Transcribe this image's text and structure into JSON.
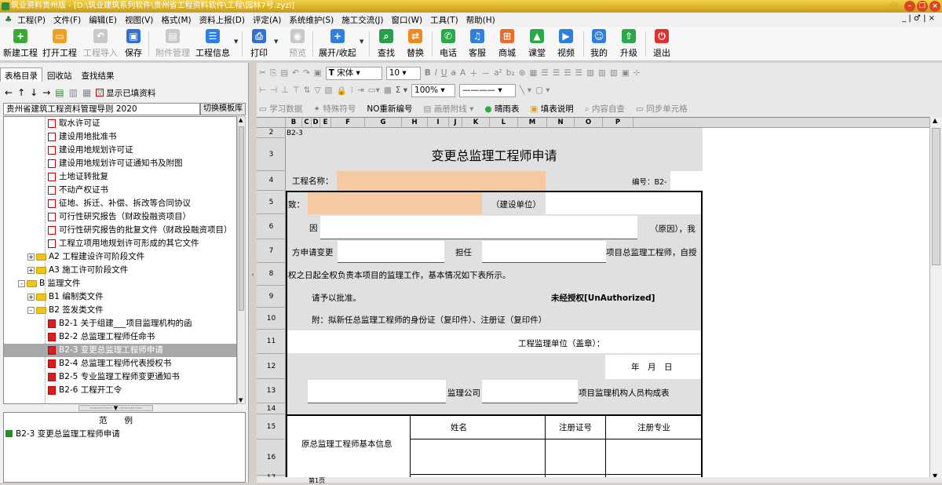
{
  "titlebar": {
    "text": "筑业资料贵州版 - [D:\\筑业建筑系列软件\\贵州省工程资料软件\\工程\\园林7号.zyzl]"
  },
  "menu": [
    "工程(P)",
    "文件(F)",
    "编辑(E)",
    "视图(V)",
    "格式(M)",
    "资料上报(D)",
    "评定(A)",
    "系统维护(S)",
    "施工交流(J)",
    "窗口(W)",
    "工具(T)",
    "帮助(H)"
  ],
  "menu_mdi": "_ | ♂ | ×",
  "toolbar": {
    "new": "新建工程",
    "open": "打开工程",
    "import": "工程导入",
    "save": "保存",
    "attach": "附件管理",
    "info": "工程信息",
    "print": "打印",
    "preview": "预览",
    "expand": "展开/收起",
    "search": "查找",
    "replace": "替换",
    "phone": "电话",
    "service": "客服",
    "shop": "商城",
    "classroom": "课堂",
    "video": "视频",
    "mine": "我的",
    "upgrade": "升级",
    "exit": "退出"
  },
  "colors": {
    "new": "#3aaa35",
    "open": "#f0a020",
    "save": "#2f6fd6",
    "info": "#2f7fe0",
    "expand": "#2f7fe0",
    "search": "#2a9d4a",
    "replace": "#f08a1e",
    "phone": "#2aa84a",
    "service": "#2f7fe0",
    "shop": "#f06a2a",
    "classroom": "#2aa84a",
    "video": "#2f7fe0",
    "mine": "#2f7fe0",
    "upgrade": "#2aa84a",
    "exit": "#e03030",
    "peach": "#f4c9a3"
  },
  "left": {
    "tabs": [
      "表格目录",
      "回收站",
      "查找结果"
    ],
    "show_filled": "显示已填资料",
    "standard": "贵州省建筑工程资料管理导则 2020",
    "switch_template": "切换模板库",
    "tree": [
      {
        "label": "取水许可证",
        "level": 3,
        "kind": "doc"
      },
      {
        "label": "建设用地批准书",
        "level": 3,
        "kind": "doc"
      },
      {
        "label": "建设用地规划许可证",
        "level": 3,
        "kind": "doc"
      },
      {
        "label": "建设用地规划许可证通知书及附图",
        "level": 3,
        "kind": "doc"
      },
      {
        "label": "土地证转批复",
        "level": 3,
        "kind": "doc"
      },
      {
        "label": "不动产权证书",
        "level": 3,
        "kind": "doc"
      },
      {
        "label": "征地、拆迁、补偿、拆改等合同协议",
        "level": 3,
        "kind": "doc"
      },
      {
        "label": "可行性研究报告（财政投融资项目）",
        "level": 3,
        "kind": "doc"
      },
      {
        "label": "可行性研究报告的批复文件（财政投融资项目）",
        "level": 3,
        "kind": "doc"
      },
      {
        "label": "工程立项用地规划许可形成的其它文件",
        "level": 3,
        "kind": "doc"
      },
      {
        "label": "A2 工程建设许可阶段文件",
        "level": 2,
        "kind": "folder",
        "exp": "+"
      },
      {
        "label": "A3 施工许可阶段文件",
        "level": 2,
        "kind": "folder",
        "exp": "+"
      },
      {
        "label": "B 监理文件",
        "level": 1,
        "kind": "folder",
        "exp": "-"
      },
      {
        "label": "B1 编制类文件",
        "level": 2,
        "kind": "folder",
        "exp": "+"
      },
      {
        "label": "B2 签发类文件",
        "level": 2,
        "kind": "folder",
        "exp": "-"
      },
      {
        "label": "B2-1 关于组建___项目监理机构的函",
        "level": 3,
        "kind": "xdoc"
      },
      {
        "label": "B2-2 总监理工程师任命书",
        "level": 3,
        "kind": "xdoc"
      },
      {
        "label": "B2-3 变更总监理工程师申请",
        "level": 3,
        "kind": "xdoc",
        "selected": true
      },
      {
        "label": "B2-4 总监理工程师代表授权书",
        "level": 3,
        "kind": "xdoc"
      },
      {
        "label": "B2-5 专业监理工程师变更通知书",
        "level": 3,
        "kind": "xdoc"
      },
      {
        "label": "B2-6 工程开工令",
        "level": 3,
        "kind": "xdoc"
      }
    ],
    "example_header": "范例",
    "example_item": "B2-3 变更总监理工程师申请"
  },
  "format": {
    "font": "宋体",
    "size": "10",
    "zoom": "100%",
    "bar3": [
      "学习数据",
      "特殊符号",
      "NO重新编号",
      "画册附线",
      "晴雨表",
      "填表说明",
      "内容自查",
      "同步单元格"
    ]
  },
  "sheet": {
    "cols": [
      "B",
      "C",
      "D",
      "E",
      "F",
      "G",
      "H",
      "I",
      "J",
      "K",
      "L",
      "M",
      "N",
      "O",
      "P"
    ],
    "rows": [
      "2",
      "3",
      "4",
      "5",
      "6",
      "7",
      "8",
      "9",
      "10",
      "11",
      "12",
      "13",
      "14",
      "15",
      "16",
      "17"
    ],
    "code": "B2-3",
    "title": "变更总监理工程师申请",
    "project_name": "工程名称：",
    "number": "编号：B2-",
    "to": "致：",
    "builder": "（建设单位）",
    "because": "因",
    "reason": "（原因），我",
    "apply": "方申请变更",
    "serve": "担任",
    "serve_tail": "项目总监理工程师，自授",
    "line8": "权之日起全权负责本项目的监理工作，基本情况如下表所示。",
    "approve": "请予以批准。",
    "unauth": "未经授权[UnAuthorized]",
    "attach": "附：拟新任总监理工程师的身份证（复印件）、注册证（复印件）",
    "seal": "工程监理单位（盖章）：",
    "date": "年　月　日",
    "company": "监理公司",
    "member": "项目监理机构人员构成表",
    "name_h": "姓名",
    "cert_h": "注册证号",
    "major_h": "注册专业",
    "orig": "原总监理工程师基本信息"
  },
  "sheettab": "第1页"
}
